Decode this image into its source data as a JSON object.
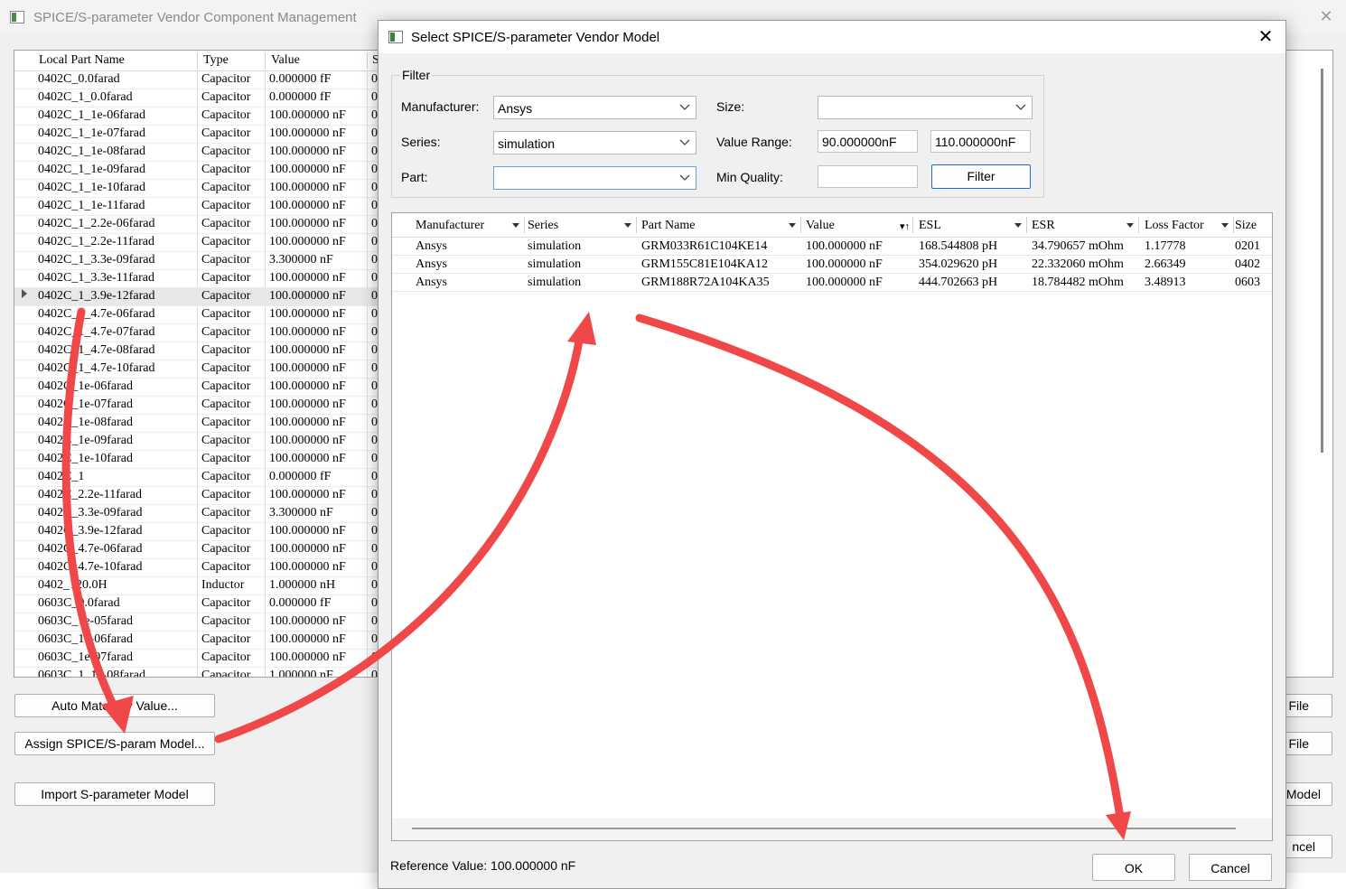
{
  "main": {
    "title": "SPICE/S-parameter Vendor Component Management",
    "columns": [
      "Local Part Name",
      "Type",
      "Value",
      "S"
    ],
    "rows": [
      [
        "0402C_0.0farad",
        "Capacitor",
        "0.000000 fF",
        "0"
      ],
      [
        "0402C_1_0.0farad",
        "Capacitor",
        "0.000000 fF",
        "0"
      ],
      [
        "0402C_1_1e-06farad",
        "Capacitor",
        "100.000000 nF",
        "0"
      ],
      [
        "0402C_1_1e-07farad",
        "Capacitor",
        "100.000000 nF",
        "0"
      ],
      [
        "0402C_1_1e-08farad",
        "Capacitor",
        "100.000000 nF",
        "0"
      ],
      [
        "0402C_1_1e-09farad",
        "Capacitor",
        "100.000000 nF",
        "0"
      ],
      [
        "0402C_1_1e-10farad",
        "Capacitor",
        "100.000000 nF",
        "0"
      ],
      [
        "0402C_1_1e-11farad",
        "Capacitor",
        "100.000000 nF",
        "0"
      ],
      [
        "0402C_1_2.2e-06farad",
        "Capacitor",
        "100.000000 nF",
        "0"
      ],
      [
        "0402C_1_2.2e-11farad",
        "Capacitor",
        "100.000000 nF",
        "0"
      ],
      [
        "0402C_1_3.3e-09farad",
        "Capacitor",
        "3.300000 nF",
        "0"
      ],
      [
        "0402C_1_3.3e-11farad",
        "Capacitor",
        "100.000000 nF",
        "0"
      ],
      [
        "0402C_1_3.9e-12farad",
        "Capacitor",
        "100.000000 nF",
        "0"
      ],
      [
        "0402C_1_4.7e-06farad",
        "Capacitor",
        "100.000000 nF",
        "0"
      ],
      [
        "0402C_1_4.7e-07farad",
        "Capacitor",
        "100.000000 nF",
        "0"
      ],
      [
        "0402C_1_4.7e-08farad",
        "Capacitor",
        "100.000000 nF",
        "0"
      ],
      [
        "0402C_1_4.7e-10farad",
        "Capacitor",
        "100.000000 nF",
        "0"
      ],
      [
        "0402C_1e-06farad",
        "Capacitor",
        "100.000000 nF",
        "0"
      ],
      [
        "0402C_1e-07farad",
        "Capacitor",
        "100.000000 nF",
        "0"
      ],
      [
        "0402C_1e-08farad",
        "Capacitor",
        "100.000000 nF",
        "0"
      ],
      [
        "0402C_1e-09farad",
        "Capacitor",
        "100.000000 nF",
        "0"
      ],
      [
        "0402C_1e-10farad",
        "Capacitor",
        "100.000000 nF",
        "0"
      ],
      [
        "0402C_1",
        "Capacitor",
        "0.000000 fF",
        "0"
      ],
      [
        "0402C_2.2e-11farad",
        "Capacitor",
        "100.000000 nF",
        "0"
      ],
      [
        "0402C_3.3e-09farad",
        "Capacitor",
        "3.300000 nF",
        "0"
      ],
      [
        "0402C_3.9e-12farad",
        "Capacitor",
        "100.000000 nF",
        "0"
      ],
      [
        "0402C_4.7e-06farad",
        "Capacitor",
        "100.000000 nF",
        "0"
      ],
      [
        "0402C_4.7e-10farad",
        "Capacitor",
        "100.000000 nF",
        "0"
      ],
      [
        "0402_120.0H",
        "Inductor",
        "1.000000 nH",
        "0"
      ],
      [
        "0603C_0.0farad",
        "Capacitor",
        "0.000000 fF",
        "0"
      ],
      [
        "0603C_1e-05farad",
        "Capacitor",
        "100.000000 nF",
        "0"
      ],
      [
        "0603C_1e-06farad",
        "Capacitor",
        "100.000000 nF",
        "0"
      ],
      [
        "0603C_1e-07farad",
        "Capacitor",
        "100.000000 nF",
        "0"
      ],
      [
        "0603C_1_1e-08farad",
        "Capacitor",
        "1.000000 nF",
        "0"
      ]
    ],
    "selected_row": 12,
    "buttons": {
      "auto_match": "Auto Match by Value...",
      "assign": "Assign SPICE/S-param Model...",
      "import": "Import S-parameter Model"
    },
    "right_buttons": [
      "File",
      "File",
      "Model",
      "ncel"
    ],
    "close_glyph": "✕"
  },
  "dialog": {
    "title": "Select SPICE/S-parameter Vendor Model",
    "close_glyph": "✕",
    "filter": {
      "legend": "Filter",
      "manufacturer_label": "Manufacturer:",
      "manufacturer_value": "Ansys",
      "series_label": "Series:",
      "series_value": "simulation",
      "part_label": "Part:",
      "part_value": "",
      "size_label": "Size:",
      "size_value": "",
      "value_range_label": "Value Range:",
      "value_min": "90.000000nF",
      "value_max": "110.000000nF",
      "min_quality_label": "Min Quality:",
      "min_quality_value": "",
      "filter_button": "Filter"
    },
    "results": {
      "columns": [
        "Manufacturer",
        "Series",
        "Part Name",
        "Value",
        "ESL",
        "ESR",
        "Loss Factor",
        "Size"
      ],
      "rows": [
        [
          "Ansys",
          "simulation",
          "GRM033R61C104KE14",
          "100.000000 nF",
          "168.544808 pH",
          "34.790657 mOhm",
          "1.17778",
          "0201"
        ],
        [
          "Ansys",
          "simulation",
          "GRM155C81E104KA12",
          "100.000000 nF",
          "354.029620 pH",
          "22.332060 mOhm",
          "2.66349",
          "0402"
        ],
        [
          "Ansys",
          "simulation",
          "GRM188R72A104KA35",
          "100.000000 nF",
          "444.702663 pH",
          "18.784482 mOhm",
          "3.48913",
          "0603"
        ]
      ]
    },
    "reference_value": "Reference Value: 100.000000 nF",
    "ok_button": "OK",
    "cancel_button": "Cancel"
  },
  "annotation_color": "#f04848"
}
